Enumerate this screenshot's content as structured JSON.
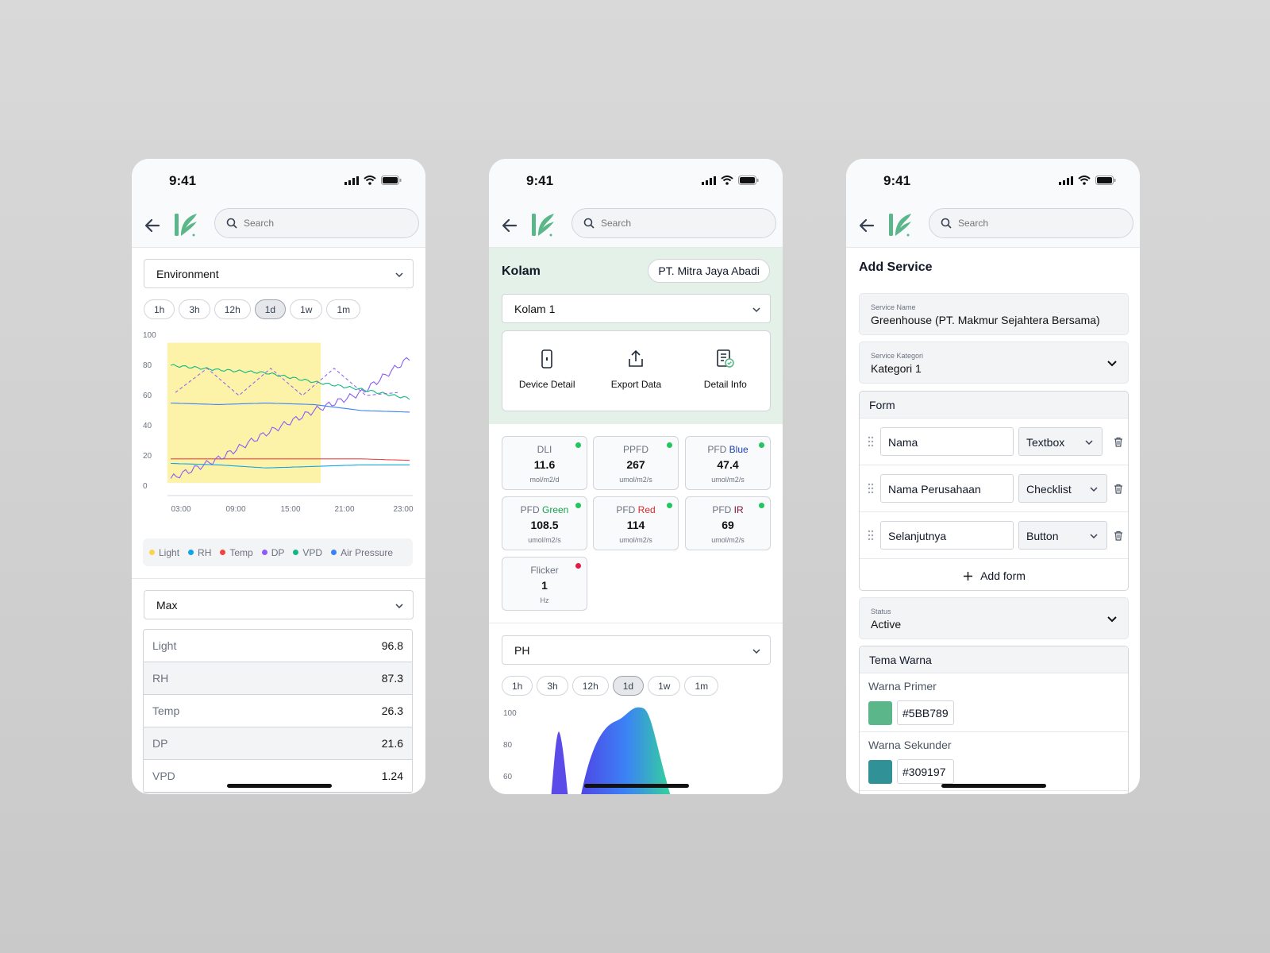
{
  "status": {
    "time": "9:41"
  },
  "search": {
    "placeholder": "Search"
  },
  "screen1": {
    "dropdown": "Environment",
    "ranges": [
      "1h",
      "3h",
      "12h",
      "1d",
      "1w",
      "1m"
    ],
    "active_range": "1d",
    "legend": [
      {
        "name": "Light",
        "color": "#fcd34d"
      },
      {
        "name": "RH",
        "color": "#0ea5e9"
      },
      {
        "name": "Temp",
        "color": "#ef4444"
      },
      {
        "name": "DP",
        "color": "#8b5cf6"
      },
      {
        "name": "VPD",
        "color": "#10b981"
      },
      {
        "name": "Air Pressure",
        "color": "#3b82f6"
      }
    ],
    "stat_dropdown": "Max",
    "stats": [
      {
        "label": "Light",
        "value": "96.8"
      },
      {
        "label": "RH",
        "value": "87.3"
      },
      {
        "label": "Temp",
        "value": "26.3"
      },
      {
        "label": "DP",
        "value": "21.6"
      },
      {
        "label": "VPD",
        "value": "1.24"
      }
    ]
  },
  "screen2": {
    "title": "Kolam",
    "company": "PT. Mitra Jaya Abadi",
    "pool_select": "Kolam 1",
    "actions": [
      {
        "label": "Device Detail",
        "icon": "device-icon"
      },
      {
        "label": "Export Data",
        "icon": "export-icon"
      },
      {
        "label": "Detail Info",
        "icon": "info-doc-icon"
      }
    ],
    "metrics": [
      {
        "prefix": "DLI",
        "suffix": "",
        "suffix_color": "",
        "value": "11.6",
        "unit": "mol/m2/d",
        "status": "#22c55e"
      },
      {
        "prefix": "PPFD",
        "suffix": "",
        "suffix_color": "",
        "value": "267",
        "unit": "umol/m2/s",
        "status": "#22c55e"
      },
      {
        "prefix": "PFD",
        "suffix": "Blue",
        "suffix_color": "#1e40af",
        "value": "47.4",
        "unit": "umol/m2/s",
        "status": "#22c55e"
      },
      {
        "prefix": "PFD",
        "suffix": "Green",
        "suffix_color": "#16a34a",
        "value": "108.5",
        "unit": "umol/m2/s",
        "status": "#22c55e"
      },
      {
        "prefix": "PFD",
        "suffix": "Red",
        "suffix_color": "#dc2626",
        "value": "114",
        "unit": "umol/m2/s",
        "status": "#22c55e"
      },
      {
        "prefix": "PFD",
        "suffix": "IR",
        "suffix_color": "#881337",
        "value": "69",
        "unit": "umol/m2/s",
        "status": "#22c55e"
      },
      {
        "prefix": "Flicker",
        "suffix": "",
        "suffix_color": "",
        "value": "1",
        "unit": "Hz",
        "status": "#e11d48"
      }
    ],
    "param_select": "PH",
    "ranges": [
      "1h",
      "3h",
      "12h",
      "1d",
      "1w",
      "1m"
    ],
    "active_range": "1d"
  },
  "screen3": {
    "title": "Add Service",
    "service_name_label": "Service Name",
    "service_name": "Greenhouse (PT. Makmur Sejahtera Bersama)",
    "kategori_label": "Service Kategori",
    "kategori": "Kategori 1",
    "form_header": "Form",
    "form_rows": [
      {
        "name": "Nama",
        "type": "Textbox"
      },
      {
        "name": "Nama Perusahaan",
        "type": "Checklist"
      },
      {
        "name": "Selanjutnya",
        "type": "Button"
      }
    ],
    "add_form": "Add form",
    "status_label": "Status",
    "status": "Active",
    "theme_header": "Tema Warna",
    "colors": [
      {
        "label": "Warna Primer",
        "hex": "#5BB789"
      },
      {
        "label": "Warna Sekunder",
        "hex": "#309197"
      }
    ]
  },
  "chart_data": [
    {
      "type": "line",
      "title": "",
      "x": [
        "03:00",
        "09:00",
        "15:00",
        "21:00",
        "23:00"
      ],
      "ylim": [
        0,
        100
      ],
      "yticks": [
        0,
        20,
        40,
        60,
        80,
        100
      ],
      "highlight_range": [
        "00:00",
        "15:00"
      ],
      "highlight_color": "#fdf3a8",
      "series": [
        {
          "name": "RH",
          "color": "#0ea5e9",
          "values": [
            15,
            14,
            12,
            13,
            14,
            14
          ]
        },
        {
          "name": "Temp",
          "color": "#ef4444",
          "values": [
            18,
            18,
            18,
            18,
            18,
            17
          ]
        },
        {
          "name": "DP",
          "color": "#8b5cf6",
          "values": [
            5,
            18,
            35,
            50,
            62,
            85
          ]
        },
        {
          "name": "VPD",
          "color": "#10b981",
          "values": [
            80,
            77,
            75,
            69,
            64,
            58
          ]
        },
        {
          "name": "Air Pressure",
          "color": "#3b82f6",
          "values": [
            55,
            54,
            55,
            54,
            50,
            49
          ]
        }
      ]
    },
    {
      "type": "area",
      "title": "",
      "ylim": [
        60,
        100
      ],
      "yticks": [
        60,
        80,
        100
      ],
      "series": [
        {
          "values": [
            0,
            0,
            60,
            78,
            60,
            40,
            60,
            85,
            90,
            96,
            89,
            76,
            60,
            40
          ]
        }
      ]
    }
  ]
}
